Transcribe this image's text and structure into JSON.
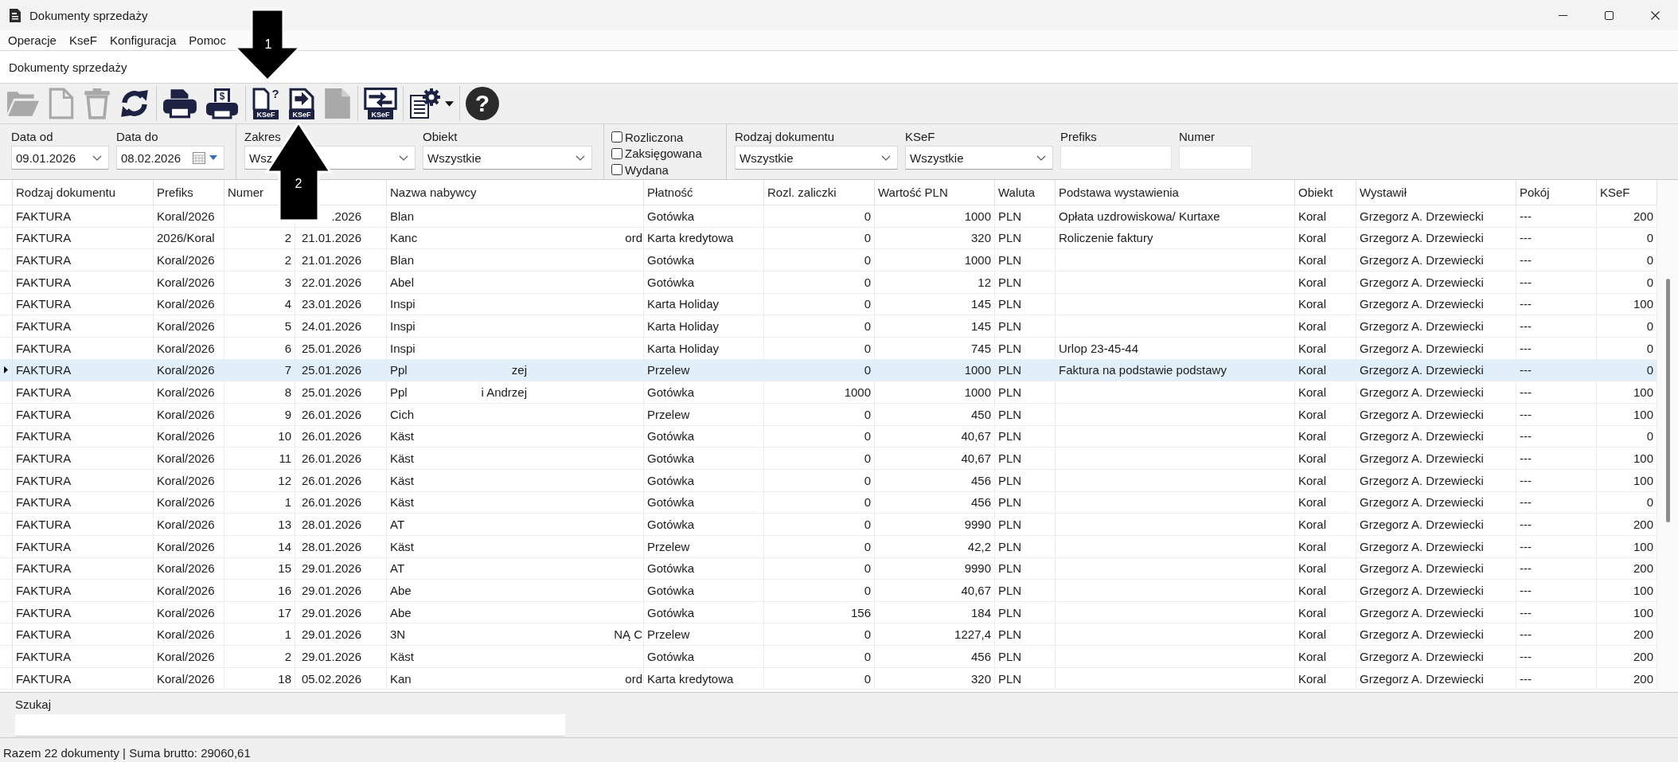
{
  "window": {
    "title": "Dokumenty sprzedaży"
  },
  "menu": [
    "Operacje",
    "KseF",
    "Konfiguracja",
    "Pomoc"
  ],
  "page_title": "Dokumenty sprzedaży",
  "toolbar": {
    "groups": [
      [
        {
          "kind": "button",
          "disabled": true
        },
        {
          "kind": "button",
          "disabled": true
        },
        {
          "kind": "button",
          "disabled": true
        },
        {
          "kind": "button",
          "disabled": false
        }
      ],
      [
        {
          "kind": "button",
          "disabled": false
        },
        {
          "kind": "button",
          "disabled": false,
          "glyph": "$"
        }
      ],
      [
        {
          "kind": "button",
          "disabled": false,
          "glyph": "?",
          "label": "KSeF"
        },
        {
          "kind": "button",
          "disabled": false,
          "label": "KSeF"
        },
        {
          "kind": "button",
          "disabled": true
        }
      ],
      [
        {
          "kind": "button",
          "disabled": false,
          "label": "KSeF"
        }
      ],
      [
        {
          "kind": "menu-button",
          "disabled": false
        }
      ],
      [
        {
          "kind": "button",
          "disabled": false,
          "glyph": "?"
        }
      ]
    ]
  },
  "filters": [
    {
      "kind": "fields",
      "fields": [
        {
          "label": "Data od",
          "kind": "date",
          "value": "09.01.2026"
        },
        {
          "label": "Data do",
          "kind": "date-picker",
          "value": "08.02.2026"
        }
      ]
    },
    {
      "kind": "fields",
      "fields": [
        {
          "label": "Zakres",
          "kind": "select",
          "value": "Wsz"
        },
        {
          "label": "Obiekt",
          "kind": "select",
          "value": "Wszystkie"
        }
      ]
    },
    {
      "kind": "checkboxes",
      "items": [
        {
          "label": "Rozliczona",
          "checked": false
        },
        {
          "label": "Zaksięgowana",
          "checked": false
        },
        {
          "label": "Wydana",
          "checked": false
        }
      ]
    },
    {
      "kind": "fields",
      "fields": [
        {
          "label": "Rodzaj dokumentu",
          "kind": "select",
          "value": "Wszystkie"
        },
        {
          "label": "KSeF",
          "kind": "select",
          "value": "Wszystkie"
        },
        {
          "label": "Prefiks",
          "kind": "text"
        },
        {
          "label": "Numer",
          "kind": "text"
        }
      ]
    }
  ],
  "table": {
    "columns": [
      {
        "label": "Rodzaj dokumentu",
        "kind": "text"
      },
      {
        "label": "Prefiks",
        "kind": "text"
      },
      {
        "label": "Numer",
        "kind": "number"
      },
      {
        "kind": "date"
      },
      {
        "label": "Nazwa nabywcy",
        "kind": "redacted"
      },
      {
        "label": "Płatność",
        "kind": "text"
      },
      {
        "label": "Rozl. zaliczki",
        "kind": "number"
      },
      {
        "label": "Wartość PLN",
        "kind": "number"
      },
      {
        "label": "Waluta",
        "kind": "text"
      },
      {
        "label": "Podstawa wystawienia",
        "kind": "text"
      },
      {
        "label": "Obiekt",
        "kind": "text"
      },
      {
        "label": "Wystawił",
        "kind": "text"
      },
      {
        "label": "Pokój",
        "kind": "text"
      },
      {
        "label": "KSeF",
        "kind": "number"
      }
    ],
    "rows": [
      {
        "rodzaj_dokumentu": "FAKTURA",
        "prefiks": "Koral/2026",
        "column_4": ".2026",
        "nazwa_nabywcy": {
          "start": "Blan"
        },
        "platnosc": "Gotówka",
        "rozl_zaliczki": "0",
        "wartosc_pln": "1000",
        "waluta": "PLN",
        "podstawa_wystawienia": "Opłata uzdrowiskowa/ Kurtaxe",
        "obiekt": "Koral",
        "wystawil": "Grzegorz A. Drzewiecki",
        "pokoj": "---",
        "ksef": "200",
        "selected": false
      },
      {
        "rodzaj_dokumentu": "FAKTURA",
        "prefiks": "2026/Koral",
        "numer": "2",
        "column_4": "21.01.2026",
        "nazwa_nabywcy": {
          "start": "Kanc",
          "end": "ord"
        },
        "platnosc": "Karta kredytowa",
        "rozl_zaliczki": "0",
        "wartosc_pln": "320",
        "waluta": "PLN",
        "podstawa_wystawienia": "Roliczenie faktury",
        "obiekt": "Koral",
        "wystawil": "Grzegorz A. Drzewiecki",
        "pokoj": "---",
        "ksef": "0",
        "selected": false
      },
      {
        "rodzaj_dokumentu": "FAKTURA",
        "prefiks": "Koral/2026",
        "numer": "2",
        "column_4": "21.01.2026",
        "nazwa_nabywcy": {
          "start": "Blan"
        },
        "platnosc": "Gotówka",
        "rozl_zaliczki": "0",
        "wartosc_pln": "1000",
        "waluta": "PLN",
        "obiekt": "Koral",
        "wystawil": "Grzegorz A. Drzewiecki",
        "pokoj": "---",
        "ksef": "0",
        "selected": false
      },
      {
        "rodzaj_dokumentu": "FAKTURA",
        "prefiks": "Koral/2026",
        "numer": "3",
        "column_4": "22.01.2026",
        "nazwa_nabywcy": {
          "start": "Abel"
        },
        "platnosc": "Gotówka",
        "rozl_zaliczki": "0",
        "wartosc_pln": "12",
        "waluta": "PLN",
        "obiekt": "Koral",
        "wystawil": "Grzegorz A. Drzewiecki",
        "pokoj": "---",
        "ksef": "0",
        "selected": false
      },
      {
        "rodzaj_dokumentu": "FAKTURA",
        "prefiks": "Koral/2026",
        "numer": "4",
        "column_4": "23.01.2026",
        "nazwa_nabywcy": {
          "start": "Inspi"
        },
        "platnosc": "Karta Holiday",
        "rozl_zaliczki": "0",
        "wartosc_pln": "145",
        "waluta": "PLN",
        "obiekt": "Koral",
        "wystawil": "Grzegorz A. Drzewiecki",
        "pokoj": "---",
        "ksef": "100",
        "selected": false
      },
      {
        "rodzaj_dokumentu": "FAKTURA",
        "prefiks": "Koral/2026",
        "numer": "5",
        "column_4": "24.01.2026",
        "nazwa_nabywcy": {
          "start": "Inspi"
        },
        "platnosc": "Karta Holiday",
        "rozl_zaliczki": "0",
        "wartosc_pln": "145",
        "waluta": "PLN",
        "obiekt": "Koral",
        "wystawil": "Grzegorz A. Drzewiecki",
        "pokoj": "---",
        "ksef": "0",
        "selected": false
      },
      {
        "rodzaj_dokumentu": "FAKTURA",
        "prefiks": "Koral/2026",
        "numer": "6",
        "column_4": "25.01.2026",
        "nazwa_nabywcy": {
          "start": "Inspi"
        },
        "platnosc": "Karta Holiday",
        "rozl_zaliczki": "0",
        "wartosc_pln": "745",
        "waluta": "PLN",
        "podstawa_wystawienia": "Urlop 23-45-44",
        "obiekt": "Koral",
        "wystawil": "Grzegorz A. Drzewiecki",
        "pokoj": "---",
        "ksef": "0",
        "selected": false
      },
      {
        "rodzaj_dokumentu": "FAKTURA",
        "prefiks": "Koral/2026",
        "numer": "7",
        "column_4": "25.01.2026",
        "nazwa_nabywcy": {
          "start": "Ppl",
          "middle": "zej"
        },
        "platnosc": "Przelew",
        "rozl_zaliczki": "0",
        "wartosc_pln": "1000",
        "waluta": "PLN",
        "podstawa_wystawienia": "Faktura na podstawie podstawy",
        "obiekt": "Koral",
        "wystawil": "Grzegorz A. Drzewiecki",
        "pokoj": "---",
        "ksef": "0",
        "selected": true
      },
      {
        "rodzaj_dokumentu": "FAKTURA",
        "prefiks": "Koral/2026",
        "numer": "8",
        "column_4": "25.01.2026",
        "nazwa_nabywcy": {
          "start": "Ppl",
          "middle": "i Andrzej"
        },
        "platnosc": "Gotówka",
        "rozl_zaliczki": "1000",
        "wartosc_pln": "1000",
        "waluta": "PLN",
        "obiekt": "Koral",
        "wystawil": "Grzegorz A. Drzewiecki",
        "pokoj": "---",
        "ksef": "100",
        "selected": false
      },
      {
        "rodzaj_dokumentu": "FAKTURA",
        "prefiks": "Koral/2026",
        "numer": "9",
        "column_4": "26.01.2026",
        "nazwa_nabywcy": {
          "start": "Cich"
        },
        "platnosc": "Przelew",
        "rozl_zaliczki": "0",
        "wartosc_pln": "450",
        "waluta": "PLN",
        "obiekt": "Koral",
        "wystawil": "Grzegorz A. Drzewiecki",
        "pokoj": "---",
        "ksef": "100",
        "selected": false
      },
      {
        "rodzaj_dokumentu": "FAKTURA",
        "prefiks": "Koral/2026",
        "numer": "10",
        "column_4": "26.01.2026",
        "nazwa_nabywcy": {
          "start": "Käst"
        },
        "platnosc": "Gotówka",
        "rozl_zaliczki": "0",
        "wartosc_pln": "40,67",
        "waluta": "PLN",
        "obiekt": "Koral",
        "wystawil": "Grzegorz A. Drzewiecki",
        "pokoj": "---",
        "ksef": "0",
        "selected": false
      },
      {
        "rodzaj_dokumentu": "FAKTURA",
        "prefiks": "Koral/2026",
        "numer": "11",
        "column_4": "26.01.2026",
        "nazwa_nabywcy": {
          "start": "Käst"
        },
        "platnosc": "Gotówka",
        "rozl_zaliczki": "0",
        "wartosc_pln": "40,67",
        "waluta": "PLN",
        "obiekt": "Koral",
        "wystawil": "Grzegorz A. Drzewiecki",
        "pokoj": "---",
        "ksef": "100",
        "selected": false
      },
      {
        "rodzaj_dokumentu": "FAKTURA",
        "prefiks": "Koral/2026",
        "numer": "12",
        "column_4": "26.01.2026",
        "nazwa_nabywcy": {
          "start": "Käst"
        },
        "platnosc": "Gotówka",
        "rozl_zaliczki": "0",
        "wartosc_pln": "456",
        "waluta": "PLN",
        "obiekt": "Koral",
        "wystawil": "Grzegorz A. Drzewiecki",
        "pokoj": "---",
        "ksef": "100",
        "selected": false
      },
      {
        "rodzaj_dokumentu": "FAKTURA",
        "prefiks": "Koral/2026",
        "numer": "1",
        "column_4": "26.01.2026",
        "nazwa_nabywcy": {
          "start": "Käst"
        },
        "platnosc": "Gotówka",
        "rozl_zaliczki": "0",
        "wartosc_pln": "456",
        "waluta": "PLN",
        "obiekt": "Koral",
        "wystawil": "Grzegorz A. Drzewiecki",
        "pokoj": "---",
        "ksef": "0",
        "selected": false
      },
      {
        "rodzaj_dokumentu": "FAKTURA",
        "prefiks": "Koral/2026",
        "numer": "13",
        "column_4": "28.01.2026",
        "nazwa_nabywcy": {
          "start": "AT"
        },
        "platnosc": "Gotówka",
        "rozl_zaliczki": "0",
        "wartosc_pln": "9990",
        "waluta": "PLN",
        "obiekt": "Koral",
        "wystawil": "Grzegorz A. Drzewiecki",
        "pokoj": "---",
        "ksef": "200",
        "selected": false
      },
      {
        "rodzaj_dokumentu": "FAKTURA",
        "prefiks": "Koral/2026",
        "numer": "14",
        "column_4": "28.01.2026",
        "nazwa_nabywcy": {
          "start": "Käst"
        },
        "platnosc": "Przelew",
        "rozl_zaliczki": "0",
        "wartosc_pln": "42,2",
        "waluta": "PLN",
        "obiekt": "Koral",
        "wystawil": "Grzegorz A. Drzewiecki",
        "pokoj": "---",
        "ksef": "100",
        "selected": false
      },
      {
        "rodzaj_dokumentu": "FAKTURA",
        "prefiks": "Koral/2026",
        "numer": "15",
        "column_4": "29.01.2026",
        "nazwa_nabywcy": {
          "start": "AT"
        },
        "platnosc": "Gotówka",
        "rozl_zaliczki": "0",
        "wartosc_pln": "9990",
        "waluta": "PLN",
        "obiekt": "Koral",
        "wystawil": "Grzegorz A. Drzewiecki",
        "pokoj": "---",
        "ksef": "200",
        "selected": false
      },
      {
        "rodzaj_dokumentu": "FAKTURA",
        "prefiks": "Koral/2026",
        "numer": "16",
        "column_4": "29.01.2026",
        "nazwa_nabywcy": {
          "start": "Abe"
        },
        "platnosc": "Gotówka",
        "rozl_zaliczki": "0",
        "wartosc_pln": "40,67",
        "waluta": "PLN",
        "obiekt": "Koral",
        "wystawil": "Grzegorz A. Drzewiecki",
        "pokoj": "---",
        "ksef": "100",
        "selected": false
      },
      {
        "rodzaj_dokumentu": "FAKTURA",
        "prefiks": "Koral/2026",
        "numer": "17",
        "column_4": "29.01.2026",
        "nazwa_nabywcy": {
          "start": "Abe"
        },
        "platnosc": "Gotówka",
        "rozl_zaliczki": "156",
        "wartosc_pln": "184",
        "waluta": "PLN",
        "obiekt": "Koral",
        "wystawil": "Grzegorz A. Drzewiecki",
        "pokoj": "---",
        "ksef": "100",
        "selected": false
      },
      {
        "rodzaj_dokumentu": "FAKTURA",
        "prefiks": "Koral/2026",
        "numer": "1",
        "column_4": "29.01.2026",
        "nazwa_nabywcy": {
          "start": "3N",
          "end": "NĄ C"
        },
        "platnosc": "Przelew",
        "rozl_zaliczki": "0",
        "wartosc_pln": "1227,4",
        "waluta": "PLN",
        "obiekt": "Koral",
        "wystawil": "Grzegorz A. Drzewiecki",
        "pokoj": "---",
        "ksef": "200",
        "selected": false
      },
      {
        "rodzaj_dokumentu": "FAKTURA",
        "prefiks": "Koral/2026",
        "numer": "2",
        "column_4": "29.01.2026",
        "nazwa_nabywcy": {
          "start": "Käst"
        },
        "platnosc": "Gotówka",
        "rozl_zaliczki": "0",
        "wartosc_pln": "456",
        "waluta": "PLN",
        "obiekt": "Koral",
        "wystawil": "Grzegorz A. Drzewiecki",
        "pokoj": "---",
        "ksef": "200",
        "selected": false
      },
      {
        "rodzaj_dokumentu": "FAKTURA",
        "prefiks": "Koral/2026",
        "numer": "18",
        "column_4": "05.02.2026",
        "nazwa_nabywcy": {
          "start": "Kan",
          "end": "ord"
        },
        "platnosc": "Karta kredytowa",
        "rozl_zaliczki": "0",
        "wartosc_pln": "320",
        "waluta": "PLN",
        "obiekt": "Koral",
        "wystawil": "Grzegorz A. Drzewiecki",
        "pokoj": "---",
        "ksef": "200",
        "selected": false
      }
    ]
  },
  "search": {
    "label": "Szukaj"
  },
  "status_bar": "Razem 22 dokumenty | Suma brutto: 29060,61",
  "annotations": [
    {
      "kind": "down",
      "label": "1"
    },
    {
      "kind": "up",
      "label": "2"
    }
  ]
}
